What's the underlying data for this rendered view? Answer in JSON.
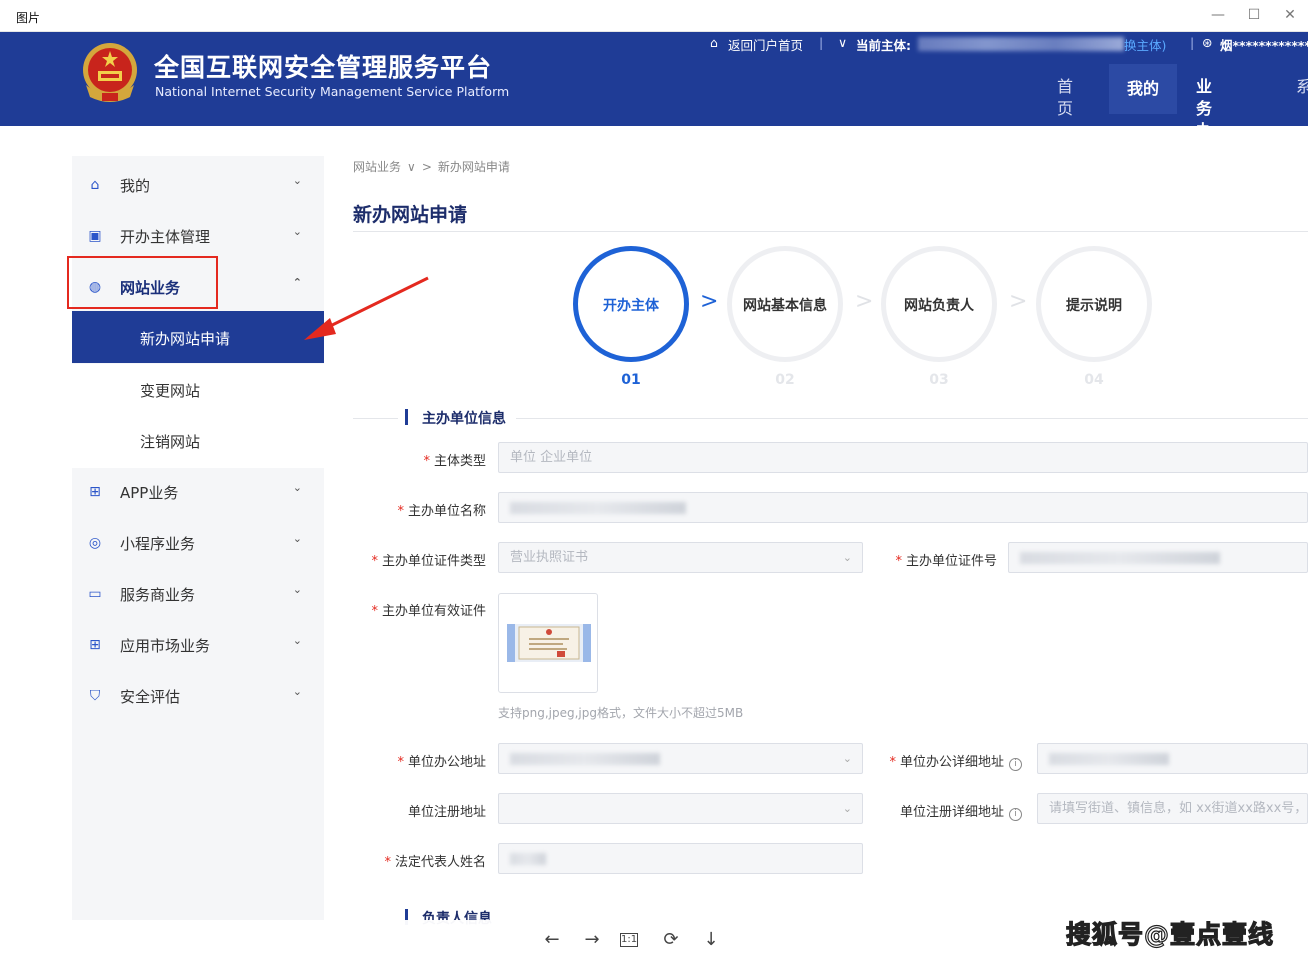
{
  "window": {
    "title": "图片",
    "minimize": "—",
    "maximize": "☐",
    "close": "✕"
  },
  "header": {
    "brand_cn": "全国互联网安全管理服务平台",
    "brand_en": "National Internet Security Management Service Platform",
    "top_links": {
      "home_portal": "返回门户首页",
      "separator": "|",
      "subject_chevron": "∨",
      "current_subject": "当前主体:",
      "switch_subject": "换主体)",
      "user": "烟*************"
    },
    "nav": [
      "首页",
      "我的",
      "业务办理",
      "系"
    ]
  },
  "sidebar": {
    "items": [
      {
        "label": "我的",
        "icon": "home-icon"
      },
      {
        "label": "开办主体管理",
        "icon": "briefcase-icon"
      },
      {
        "label": "网站业务",
        "icon": "globe-icon"
      },
      {
        "label": "APP业务",
        "icon": "apps-icon"
      },
      {
        "label": "小程序业务",
        "icon": "compass-icon"
      },
      {
        "label": "服务商业务",
        "icon": "monitor-icon"
      },
      {
        "label": "应用市场业务",
        "icon": "grid-icon"
      },
      {
        "label": "安全评估",
        "icon": "shield-icon"
      }
    ],
    "sub_items": [
      "新办网站申请",
      "变更网站",
      "注销网站"
    ],
    "chevron_down": "⌄",
    "chevron_up": "⌃"
  },
  "breadcrumb": {
    "parent": "网站业务",
    "arrow": "∨",
    "sep": ">",
    "current": "新办网站申请"
  },
  "page_title": "新办网站申请",
  "steps": [
    {
      "label": "开办主体",
      "num": "01"
    },
    {
      "label": "网站基本信息",
      "num": "02"
    },
    {
      "label": "网站负责人",
      "num": "03"
    },
    {
      "label": "提示说明",
      "num": "04"
    }
  ],
  "step_arrow": ">",
  "section1": {
    "title": "主办单位信息",
    "fields": {
      "subject_type": {
        "label": "主体类型",
        "value": "单位 企业单位"
      },
      "org_name": {
        "label": "主办单位名称",
        "value": ""
      },
      "cert_type": {
        "label": "主办单位证件类型",
        "value": "营业执照证书"
      },
      "cert_no": {
        "label": "主办单位证件号",
        "value": ""
      },
      "cert_file": {
        "label": "主办单位有效证件",
        "hint": "支持png,jpeg,jpg格式，文件大小不超过5MB"
      },
      "office_addr": {
        "label": "单位办公地址",
        "value": ""
      },
      "office_detail": {
        "label": "单位办公详细地址",
        "value": ""
      },
      "reg_addr": {
        "label": "单位注册地址",
        "value": ""
      },
      "reg_detail": {
        "label": "单位注册详细地址",
        "placeholder": "请填写街道、镇信息，如 xx街道xx路xx号，x"
      },
      "legal_rep": {
        "label": "法定代表人姓名",
        "value": ""
      }
    }
  },
  "section2": {
    "title": "负责人信息"
  },
  "viewer": {
    "prev": "←",
    "next": "→",
    "actual": "1:1",
    "rotate": "⟳",
    "download": "↓"
  },
  "watermark": "搜狐号@壹点壹线",
  "colors": {
    "header": "#1f3c96",
    "accent": "#1e62d6",
    "annotation": "#e4291f"
  }
}
